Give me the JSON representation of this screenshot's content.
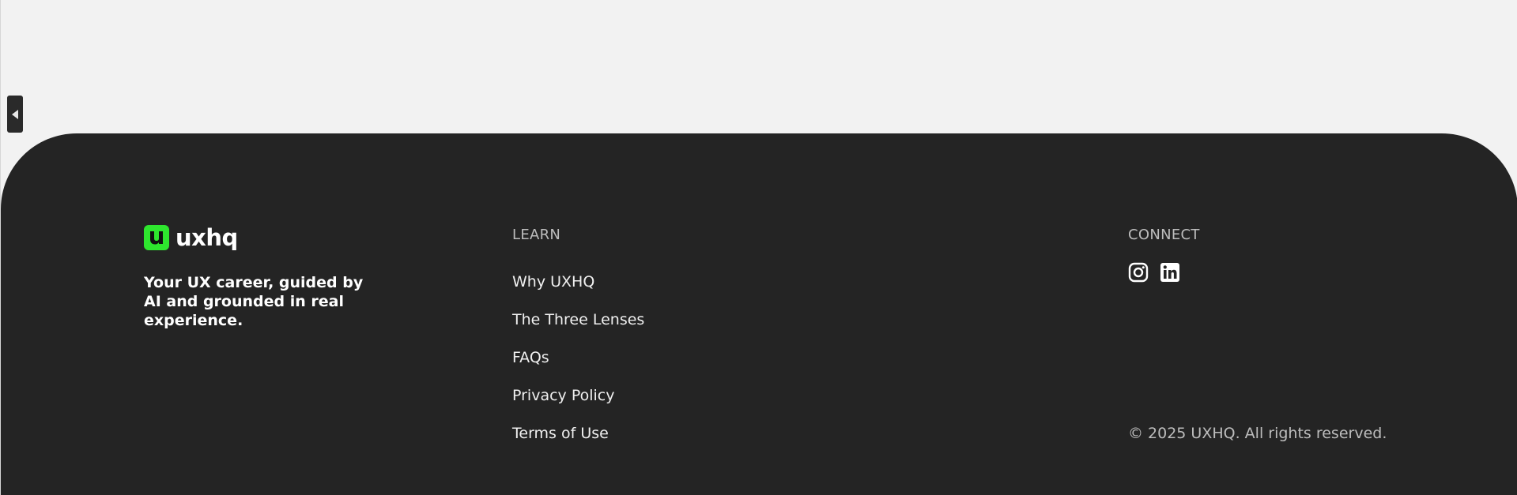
{
  "brand": {
    "name": "uxhq",
    "logo_color": "#2ee62e",
    "tagline": "Your UX career, guided by AI and grounded in real experience."
  },
  "learn": {
    "heading": "LEARN",
    "links": [
      {
        "label": "Why UXHQ"
      },
      {
        "label": "The Three Lenses"
      },
      {
        "label": "FAQs"
      },
      {
        "label": "Privacy Policy"
      },
      {
        "label": "Terms of Use"
      }
    ]
  },
  "connect": {
    "heading": "CONNECT",
    "icons": [
      "instagram-icon",
      "linkedin-icon"
    ]
  },
  "copyright": "© 2025 UXHQ. All rights reserved.",
  "colors": {
    "footer_bg": "#242424",
    "page_bg": "#f2f2f2",
    "accent": "#2ee62e"
  }
}
